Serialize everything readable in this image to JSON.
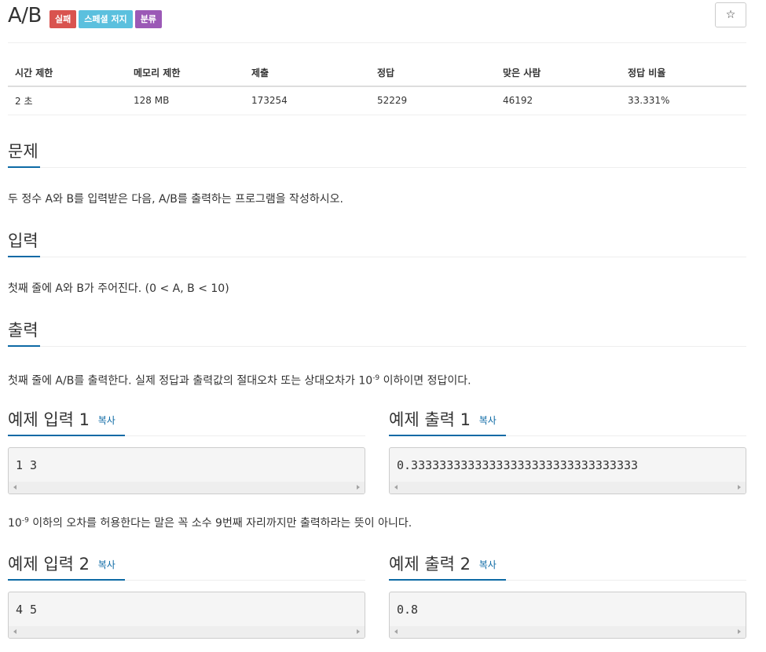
{
  "problem": {
    "title": "A/B",
    "labels": {
      "fail": "실패",
      "special_judge": "스페셜 저지",
      "category": "분류"
    },
    "star_icon": "☆"
  },
  "info_table": {
    "headers": [
      "시간 제한",
      "메모리 제한",
      "제출",
      "정답",
      "맞은 사람",
      "정답 비율"
    ],
    "values": [
      "2 초",
      "128 MB",
      "173254",
      "52229",
      "46192",
      "33.331%"
    ]
  },
  "sections": {
    "problem": {
      "title": "문제",
      "text": "두 정수 A와 B를 입력받은 다음, A/B를 출력하는 프로그램을 작성하시오."
    },
    "input": {
      "title": "입력",
      "text": "첫째 줄에 A와 B가 주어진다. (0 < A, B < 10)"
    },
    "output": {
      "title": "출력",
      "text_before": "첫째 줄에 A/B를 출력한다. 실제 정답과 출력값의 절대오차 또는 상대오차가 10",
      "sup": "-9",
      "text_after": " 이하이면 정답이다."
    }
  },
  "samples": [
    {
      "input_title": "예제 입력 1",
      "output_title": "예제 출력 1",
      "input": "1 3",
      "output": "0.33333333333333333333333333333333"
    },
    {
      "input_title": "예제 입력 2",
      "output_title": "예제 출력 2",
      "input": "4 5",
      "output": "0.8"
    }
  ],
  "copy_label": "복사",
  "sample_note": {
    "base": "10",
    "sup": "-9",
    "text": " 이하의 오차를 허용한다는 말은 꼭 소수 9번째 자리까지만 출력하라는 뜻이 아니다."
  },
  "colors": {
    "accent": "#0d6aa5",
    "label_fail": "#d9534f",
    "label_special": "#5bc0de",
    "label_category": "#9b59b6"
  }
}
